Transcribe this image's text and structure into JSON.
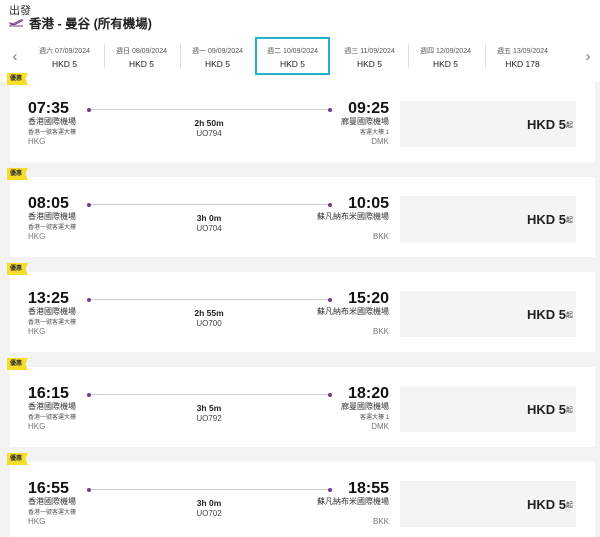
{
  "header": {
    "departure_label": "出發",
    "route": "香港 - 曼谷 (所有機場)",
    "icon": "plane-takeoff-icon"
  },
  "date_strip": {
    "prev_icon": "chevron-left-icon",
    "next_icon": "chevron-right-icon",
    "dates": [
      {
        "label": "週六 07/09/2024",
        "price": "HKD  5"
      },
      {
        "label": "週日 08/09/2024",
        "price": "HKD  5"
      },
      {
        "label": "週一 09/09/2024",
        "price": "HKD  5"
      },
      {
        "label": "週二 10/09/2024",
        "price": "HKD  5",
        "selected": true
      },
      {
        "label": "週三 11/09/2024",
        "price": "HKD  5"
      },
      {
        "label": "週四 12/09/2024",
        "price": "HKD  5"
      },
      {
        "label": "週五 13/09/2024",
        "price": "HKD  178"
      }
    ]
  },
  "flights": [
    {
      "badge": "優惠",
      "dep_time": "07:35",
      "dep_airport": "香港國際機場",
      "dep_terminal": "香港一號客運大樓",
      "dep_code": "HKG",
      "arr_time": "09:25",
      "arr_airport": "廊曼國際機場",
      "arr_terminal": "客運大樓 1",
      "arr_code": "DMK",
      "duration": "2h 50m",
      "flight_no": "UO794",
      "price": "HKD  5",
      "price_suffix": "起"
    },
    {
      "badge": "優惠",
      "dep_time": "08:05",
      "dep_airport": "香港國際機場",
      "dep_terminal": "香港一號客運大樓",
      "dep_code": "HKG",
      "arr_time": "10:05",
      "arr_airport": "蘇凡納布米國際機場",
      "arr_terminal": "",
      "arr_code": "BKK",
      "duration": "3h 0m",
      "flight_no": "UO704",
      "price": "HKD  5",
      "price_suffix": "起"
    },
    {
      "badge": "優惠",
      "dep_time": "13:25",
      "dep_airport": "香港國際機場",
      "dep_terminal": "香港一號客運大樓",
      "dep_code": "HKG",
      "arr_time": "15:20",
      "arr_airport": "蘇凡納布米國際機場",
      "arr_terminal": "",
      "arr_code": "BKK",
      "duration": "2h 55m",
      "flight_no": "UO700",
      "price": "HKD  5",
      "price_suffix": "起"
    },
    {
      "badge": "優惠",
      "dep_time": "16:15",
      "dep_airport": "香港國際機場",
      "dep_terminal": "香港一號客運大樓",
      "dep_code": "HKG",
      "arr_time": "18:20",
      "arr_airport": "廊曼國際機場",
      "arr_terminal": "客運大樓 1",
      "arr_code": "DMK",
      "duration": "3h 5m",
      "flight_no": "UO792",
      "price": "HKD  5",
      "price_suffix": "起"
    },
    {
      "badge": "優惠",
      "dep_time": "16:55",
      "dep_airport": "香港國際機場",
      "dep_terminal": "香港一號客運大樓",
      "dep_code": "HKG",
      "arr_time": "18:55",
      "arr_airport": "蘇凡納布米國際機場",
      "arr_terminal": "",
      "arr_code": "BKK",
      "duration": "3h 0m",
      "flight_no": "UO702",
      "price": "HKD  5",
      "price_suffix": "起"
    }
  ],
  "colors": {
    "accent": "#1fb3c4",
    "route_dot": "#7a3a8c",
    "promo": "#f6dc2b"
  }
}
